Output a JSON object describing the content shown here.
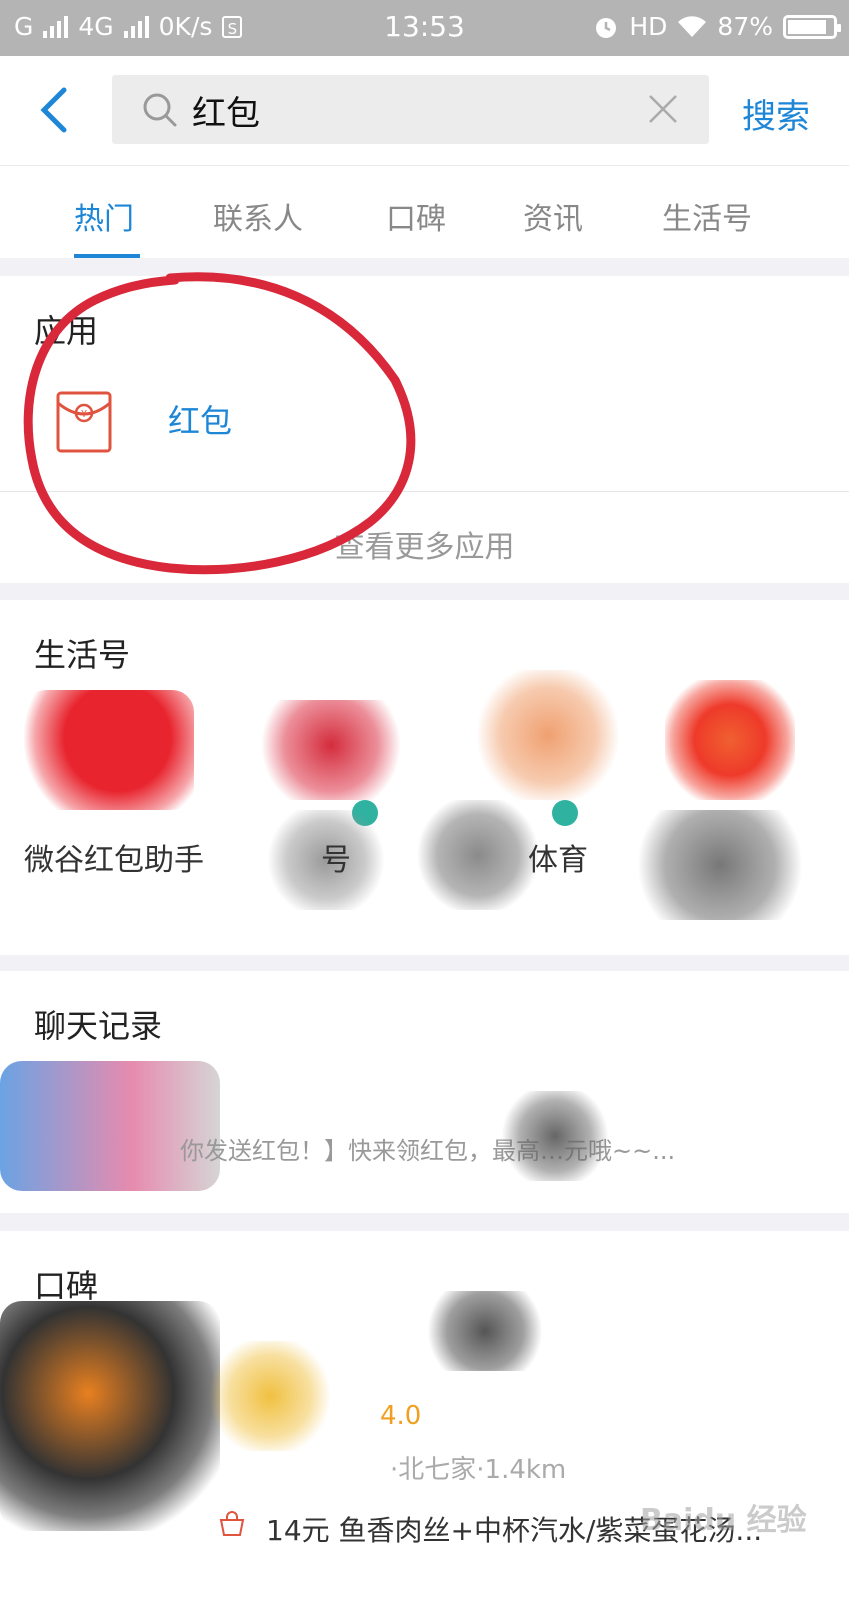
{
  "status_bar": {
    "network": "G",
    "network_4g": "4G",
    "speed": "0K/s",
    "s_badge": "S",
    "time": "13:53",
    "hd": "HD",
    "battery_percent": "87%",
    "battery_level": 0.87
  },
  "search": {
    "query": "红包",
    "button_label": "搜索"
  },
  "tabs": [
    {
      "label": "热门",
      "active": true
    },
    {
      "label": "联系人",
      "active": false
    },
    {
      "label": "口碑",
      "active": false
    },
    {
      "label": "资讯",
      "active": false
    },
    {
      "label": "生活号",
      "active": false
    }
  ],
  "apps": {
    "title": "应用",
    "items": [
      {
        "name": "红包",
        "icon": "red-envelope-icon"
      }
    ],
    "more_label": "查看更多应用"
  },
  "life_accounts": {
    "title": "生活号",
    "items": [
      {
        "name": "微谷红包助手",
        "verified": false
      },
      {
        "name": "号",
        "verified": true
      },
      {
        "name": "体育",
        "verified": true
      },
      {
        "name": "",
        "verified": false
      }
    ]
  },
  "chat_history": {
    "title": "聊天记录",
    "preview": "你发送红包！】快来领红包，最高…元哦~~..."
  },
  "koubei": {
    "title": "口碑",
    "rating": "4.0",
    "location": "·北七家·1.4km",
    "deal": "14元 鱼香肉丝+中杯汽水/紫菜蛋花汤..."
  },
  "watermark": "Baidu 经验",
  "colors": {
    "accent": "#1e86d6",
    "red_envelope": "#e0533f",
    "annotation_red": "#d8283a",
    "verified": "#2fb2a0"
  }
}
